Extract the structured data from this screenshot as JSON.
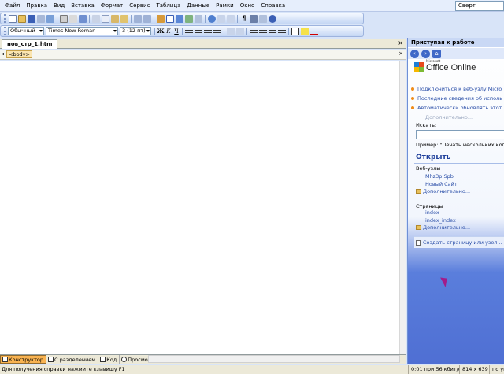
{
  "menubar": {
    "items": [
      "Файл",
      "Правка",
      "Вид",
      "Вставка",
      "Формат",
      "Сервис",
      "Таблица",
      "Данные",
      "Рамки",
      "Окно",
      "Справка"
    ],
    "help_box": "Сверт"
  },
  "format_toolbar": {
    "style": "Обычный",
    "font": "Times New Roman",
    "size": "3  (12 пт)",
    "bold": "Ж",
    "italic": "К",
    "underline": "Ч"
  },
  "document": {
    "tab_label": "нов_стр_1.htm",
    "close": "×",
    "tag_chip": "<body>",
    "view_tabs": [
      "Конструктор",
      "С разделением",
      "Код",
      "Просмотр"
    ]
  },
  "taskpane": {
    "title": "Приступая к работе",
    "logo_text": "Office Online",
    "logo_small": "Microsoft",
    "links": [
      "Подключиться к веб-узлу Micro",
      "Последние сведения об исполь",
      "Автоматически обновлять этот"
    ],
    "more_label": "Дополнительно...",
    "search_label": "Искать:",
    "example_label": "Пример:  \"Печать нескольких копий\"",
    "open_header": "Открыть",
    "websites_label": "Веб-узлы",
    "websites": [
      "Mhz3p.Spb",
      "Новый Сайт"
    ],
    "websites_more": "Дополнительно...",
    "pages_label": "Страницы",
    "pages": [
      "index",
      "index_index"
    ],
    "pages_more": "Дополнительно...",
    "create_label": "Создать страницу или узел..."
  },
  "statusbar": {
    "text": "Для получения справки нажмите клавишу F1",
    "speed": "0:01 при 56 кбит/с",
    "dimensions": "814 x 639",
    "extra": "по ум"
  },
  "colors": {
    "accent": "#3f68c7",
    "active_view_tab": "#f9b351",
    "taskpane_bottom": "#4f6fd3"
  }
}
